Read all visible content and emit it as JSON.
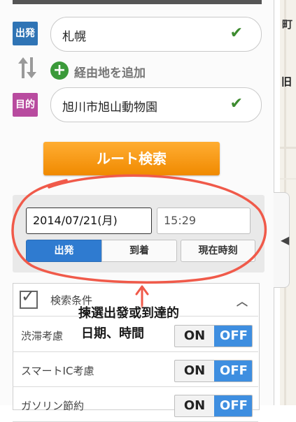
{
  "route": {
    "origin_tag": "出発",
    "origin_value": "札幌",
    "via_label": "経由地を追加",
    "dest_tag": "目的",
    "dest_value": "旭川市旭山動物園",
    "search_button": "ルート検索"
  },
  "datetime": {
    "date": "2014/07/21(月)",
    "time": "15:29",
    "modes": [
      "出発",
      "到着",
      "現在時刻"
    ],
    "selected_mode": "出発"
  },
  "annotation": {
    "line1": "揀選出發或到達的",
    "line2": "日期、時間"
  },
  "conditions": {
    "title": "検索条件",
    "rows": [
      {
        "label": "渋滞考慮",
        "on_label": "ON",
        "off_label": "OFF",
        "state": "OFF"
      },
      {
        "label": "スマートIC考慮",
        "on_label": "ON",
        "off_label": "OFF",
        "state": "OFF"
      },
      {
        "label": "ガソリン節約",
        "on_label": "ON",
        "off_label": "OFF",
        "state": "OFF"
      }
    ]
  },
  "map": {
    "label_top": "町",
    "label_mid": "旧"
  },
  "colors": {
    "origin_tag": "#2f74b5",
    "dest_tag": "#b84b9f",
    "search_button": "#f39200",
    "segment_active": "#2f7bd0",
    "toggle_off": "#3e8ee0",
    "annotation": "#f05a4a"
  },
  "icons": {
    "check": "check-icon",
    "swap": "swap-arrows-icon",
    "add": "plus-circle-icon",
    "chevron": "chevron-up-icon",
    "side": "chevron-left-icon"
  }
}
